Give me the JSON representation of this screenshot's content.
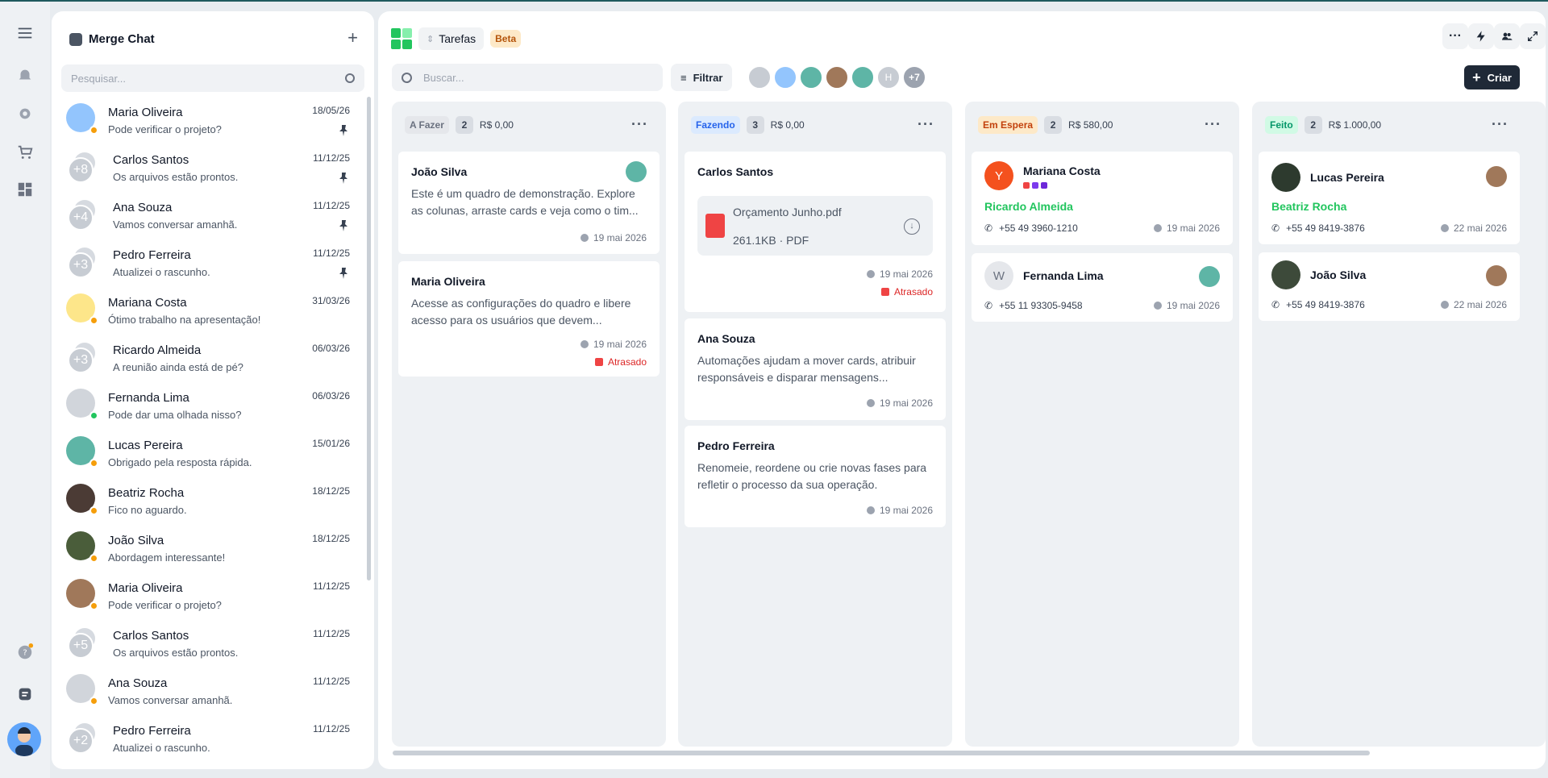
{
  "chat": {
    "title": "Merge Chat",
    "search_placeholder": "Pesquisar...",
    "items": [
      {
        "name": "Maria Oliveira",
        "msg": "Pode verificar o projeto?",
        "date": "18/05/26",
        "pinned": true,
        "group": "",
        "status": "away",
        "avatar": "man-blue"
      },
      {
        "name": "Carlos Santos",
        "msg": "Os arquivos estão prontos.",
        "date": "11/12/25",
        "pinned": true,
        "group": "+8",
        "status": "",
        "avatar": ""
      },
      {
        "name": "Ana Souza",
        "msg": "Vamos conversar amanhã.",
        "date": "11/12/25",
        "pinned": true,
        "group": "+4",
        "status": "",
        "avatar": ""
      },
      {
        "name": "Pedro Ferreira",
        "msg": "Atualizei o rascunho.",
        "date": "11/12/25",
        "pinned": true,
        "group": "+3",
        "status": "",
        "avatar": ""
      },
      {
        "name": "Mariana Costa",
        "msg": "Ótimo trabalho na apresentação!",
        "date": "31/03/26",
        "pinned": false,
        "group": "",
        "status": "away",
        "avatar": "beard"
      },
      {
        "name": "Ricardo Almeida",
        "msg": "A reunião ainda está de pé?",
        "date": "06/03/26",
        "pinned": false,
        "group": "+3",
        "status": "",
        "avatar": ""
      },
      {
        "name": "Fernanda Lima",
        "msg": "Pode dar uma olhada nisso?",
        "date": "06/03/26",
        "pinned": false,
        "group": "",
        "status": "online",
        "avatar": "default"
      },
      {
        "name": "Lucas Pereira",
        "msg": "Obrigado pela resposta rápida.",
        "date": "15/01/26",
        "pinned": false,
        "group": "",
        "status": "away",
        "avatar": "man-teal"
      },
      {
        "name": "Beatriz Rocha",
        "msg": "Fico no aguardo.",
        "date": "18/12/25",
        "pinned": false,
        "group": "",
        "status": "away",
        "avatar": "photo-dark"
      },
      {
        "name": "João Silva",
        "msg": "Abordagem interessante!",
        "date": "18/12/25",
        "pinned": false,
        "group": "",
        "status": "away",
        "avatar": "photo-green"
      },
      {
        "name": "Maria Oliveira",
        "msg": "Pode verificar o projeto?",
        "date": "11/12/25",
        "pinned": false,
        "group": "",
        "status": "away",
        "avatar": "photo-man"
      },
      {
        "name": "Carlos Santos",
        "msg": "Os arquivos estão prontos.",
        "date": "11/12/25",
        "pinned": false,
        "group": "+5",
        "status": "",
        "avatar": ""
      },
      {
        "name": "Ana Souza",
        "msg": "Vamos conversar amanhã.",
        "date": "11/12/25",
        "pinned": false,
        "group": "",
        "status": "away",
        "avatar": "default"
      },
      {
        "name": "Pedro Ferreira",
        "msg": "Atualizei o rascunho.",
        "date": "11/12/25",
        "pinned": false,
        "group": "+2",
        "status": "",
        "avatar": ""
      }
    ]
  },
  "board": {
    "tab_label": "Tarefas",
    "beta_label": "Beta",
    "search_placeholder": "Buscar...",
    "filter_label": "Filtrar",
    "avatar_initial": "H",
    "avatar_more": "+7",
    "create_label": "Criar",
    "columns": [
      {
        "tag": "A Fazer",
        "count": "2",
        "value": "R$ 0,00",
        "tag_bg": "#e5e7eb",
        "tag_fg": "#6b7280"
      },
      {
        "tag": "Fazendo",
        "count": "3",
        "value": "R$ 0,00",
        "tag_bg": "#dbeafe",
        "tag_fg": "#2563eb"
      },
      {
        "tag": "Em Espera",
        "count": "2",
        "value": "R$ 580,00",
        "tag_bg": "#fde9c8",
        "tag_fg": "#c2410c"
      },
      {
        "tag": "Feito",
        "count": "2",
        "value": "R$ 1.000,00",
        "tag_bg": "#d1fae5",
        "tag_fg": "#059669"
      }
    ],
    "todo": [
      {
        "title": "João Silva",
        "desc": "Este é um quadro de demonstração. Explore as colunas, arraste cards e veja como o tim...",
        "date": "19 mai 2026"
      },
      {
        "title": "Maria Oliveira",
        "desc": "Acesse as configurações do quadro e libere acesso para os usuários que devem...",
        "date": "19 mai 2026",
        "late": "Atrasado"
      }
    ],
    "doing": [
      {
        "title": "Carlos Santos",
        "file": "Orçamento Junho.pdf",
        "file_meta": "261.1KB · PDF",
        "date": "19 mai 2026",
        "late": "Atrasado"
      },
      {
        "title": "Ana Souza",
        "desc": "Automações ajudam a mover cards, atribuir responsáveis e disparar mensagens...",
        "date": "19 mai 2026"
      },
      {
        "title": "Pedro Ferreira",
        "desc": "Renomeie, reordene ou crie novas fases para refletir o processo da sua operação.",
        "date": "19 mai 2026"
      }
    ],
    "waiting": [
      {
        "title": "Mariana Costa",
        "initial": "Y",
        "sub": "Ricardo Almeida",
        "phone": "+55 49 3960-1210",
        "date": "19 mai 2026"
      },
      {
        "title": "Fernanda Lima",
        "initial": "W",
        "phone": "+55 11 93305-9458",
        "date": "19 mai 2026"
      }
    ],
    "done": [
      {
        "title": "Lucas Pereira",
        "sub": "Beatriz Rocha",
        "phone": "+55 49 8419-3876",
        "date": "22 mai 2026"
      },
      {
        "title": "João Silva",
        "phone": "+55 49 8419-3876",
        "date": "22 mai 2026"
      }
    ]
  },
  "colors": {
    "accent": "#22c55e",
    "dark_button": "#1f2937",
    "late": "#dc2626",
    "away": "#f59e0b",
    "online": "#22c55e"
  }
}
